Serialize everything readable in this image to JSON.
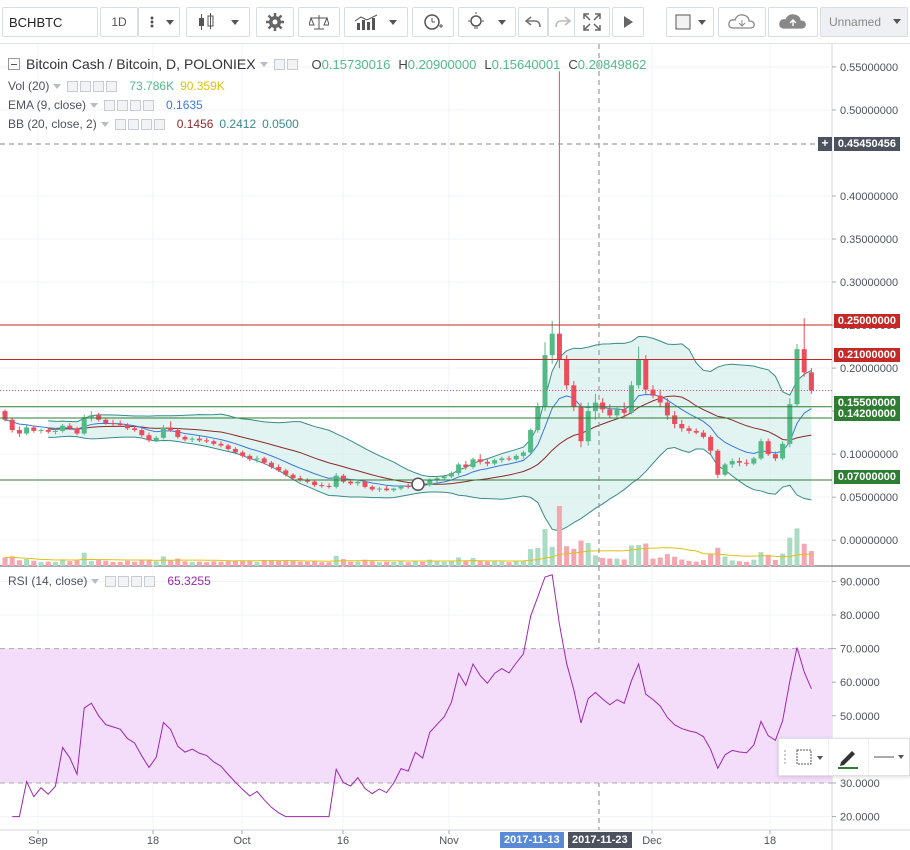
{
  "toolbar": {
    "symbol": "BCHBTC",
    "interval": "1D",
    "layout_name": "Unnamed",
    "icons": [
      "more-dots-icon",
      "candle-style-icon",
      "settings-gear-icon",
      "compare-scales-icon",
      "indicators-icon",
      "alert-clock-icon",
      "bulb-icon",
      "undo-icon",
      "redo-icon",
      "fullscreen-icon",
      "play-icon",
      "drawing-square-icon",
      "cloud-download-icon",
      "cloud-upload-icon"
    ]
  },
  "main_legend": {
    "title": "Bitcoin Cash / Bitcoin, D, POLONIEX",
    "open_key": "O",
    "open": "0.15730016",
    "high_key": "H",
    "high": "0.20900000",
    "low_key": "L",
    "low": "0.15640001",
    "close_key": "C",
    "close": "0.20849862"
  },
  "indicators": [
    {
      "name": "Vol (20)",
      "values": [
        "73.786K",
        "90.359K"
      ],
      "colors": [
        "#53b987",
        "#e0c10f"
      ]
    },
    {
      "name": "EMA (9, close)",
      "values": [
        "0.1635"
      ],
      "colors": [
        "#3c78d8"
      ]
    },
    {
      "name": "BB (20, close, 2)",
      "values": [
        "0.1456",
        "0.2412",
        "0.0500"
      ],
      "colors": [
        "#8c2a2a",
        "#3a8a8a",
        "#3a8a8a"
      ]
    }
  ],
  "rsi_legend": {
    "name": "RSI (14, close)",
    "value": "65.3255",
    "color": "#9c27b0"
  },
  "price_axis": [
    "0.55000000",
    "0.50000000",
    "0.45450456",
    "0.40000000",
    "0.35000000",
    "0.30000000",
    "0.25000000",
    "0.20000000",
    "0.15000000",
    "0.10000000",
    "0.05000000",
    "0.00000000"
  ],
  "rsi_axis": [
    "90.0000",
    "80.0000",
    "70.0000",
    "60.0000",
    "50.0000",
    "40.0000",
    "30.0000",
    "20.0000"
  ],
  "time_axis": [
    "Sep",
    "18",
    "Oct",
    "16",
    "Nov",
    "Dec",
    "18"
  ],
  "crosshair_price": "0.45450456",
  "crosshair_dates": [
    "2017-11-13",
    "2017-11-23"
  ],
  "horizontal_levels": [
    {
      "label": "0.25000000",
      "color": "#c62828"
    },
    {
      "label": "0.21000000",
      "color": "#c62828"
    },
    {
      "label": "0.15500000",
      "color": "#2e7d32"
    },
    {
      "label": "0.14200000",
      "color": "#2e7d32"
    },
    {
      "label": "0.07000000",
      "color": "#2e7d32"
    }
  ],
  "colors": {
    "up": "#53b987",
    "down": "#eb4d5c",
    "bb_fill": "#c8ebe6",
    "rsi_band": "#f3ddfa",
    "rsi_line": "#9c27b0",
    "vol_ma": "#e0c10f",
    "ema": "#3c78d8",
    "bb_basis": "#8c2a2a",
    "bb_band": "#3a8a8a"
  },
  "chart_data": {
    "type": "candlestick",
    "series_name": "BCHBTC",
    "price_range": [
      -0.03,
      0.565
    ],
    "rsi_range": [
      16,
      94
    ],
    "candles": [
      [
        0.15,
        0.152,
        0.138,
        0.14
      ],
      [
        0.14,
        0.142,
        0.125,
        0.128
      ],
      [
        0.128,
        0.132,
        0.12,
        0.124
      ],
      [
        0.124,
        0.134,
        0.122,
        0.131
      ],
      [
        0.131,
        0.133,
        0.125,
        0.127
      ],
      [
        0.127,
        0.13,
        0.124,
        0.128
      ],
      [
        0.128,
        0.131,
        0.124,
        0.126
      ],
      [
        0.126,
        0.13,
        0.123,
        0.127
      ],
      [
        0.127,
        0.135,
        0.125,
        0.133
      ],
      [
        0.133,
        0.136,
        0.128,
        0.13
      ],
      [
        0.13,
        0.132,
        0.122,
        0.124
      ],
      [
        0.124,
        0.146,
        0.122,
        0.143
      ],
      [
        0.143,
        0.15,
        0.138,
        0.145
      ],
      [
        0.145,
        0.148,
        0.138,
        0.14
      ],
      [
        0.14,
        0.142,
        0.134,
        0.136
      ],
      [
        0.136,
        0.14,
        0.133,
        0.135
      ],
      [
        0.135,
        0.139,
        0.132,
        0.134
      ],
      [
        0.134,
        0.136,
        0.128,
        0.13
      ],
      [
        0.13,
        0.133,
        0.126,
        0.128
      ],
      [
        0.128,
        0.131,
        0.12,
        0.122
      ],
      [
        0.122,
        0.125,
        0.114,
        0.116
      ],
      [
        0.116,
        0.121,
        0.114,
        0.119
      ],
      [
        0.119,
        0.134,
        0.117,
        0.131
      ],
      [
        0.131,
        0.138,
        0.126,
        0.128
      ],
      [
        0.128,
        0.13,
        0.118,
        0.12
      ],
      [
        0.12,
        0.122,
        0.115,
        0.117
      ],
      [
        0.117,
        0.12,
        0.114,
        0.118
      ],
      [
        0.118,
        0.121,
        0.114,
        0.116
      ],
      [
        0.116,
        0.119,
        0.113,
        0.115
      ],
      [
        0.115,
        0.117,
        0.11,
        0.112
      ],
      [
        0.112,
        0.115,
        0.108,
        0.11
      ],
      [
        0.11,
        0.112,
        0.104,
        0.106
      ],
      [
        0.106,
        0.108,
        0.1,
        0.102
      ],
      [
        0.102,
        0.104,
        0.096,
        0.098
      ],
      [
        0.098,
        0.1,
        0.092,
        0.094
      ],
      [
        0.094,
        0.098,
        0.09,
        0.095
      ],
      [
        0.095,
        0.097,
        0.088,
        0.09
      ],
      [
        0.09,
        0.092,
        0.083,
        0.085
      ],
      [
        0.085,
        0.088,
        0.079,
        0.081
      ],
      [
        0.081,
        0.083,
        0.074,
        0.076
      ],
      [
        0.076,
        0.078,
        0.07,
        0.072
      ],
      [
        0.072,
        0.075,
        0.068,
        0.07
      ],
      [
        0.07,
        0.072,
        0.066,
        0.068
      ],
      [
        0.068,
        0.07,
        0.062,
        0.064
      ],
      [
        0.064,
        0.067,
        0.061,
        0.063
      ],
      [
        0.063,
        0.066,
        0.06,
        0.062
      ],
      [
        0.062,
        0.078,
        0.06,
        0.075
      ],
      [
        0.075,
        0.077,
        0.066,
        0.068
      ],
      [
        0.068,
        0.071,
        0.064,
        0.066
      ],
      [
        0.066,
        0.07,
        0.063,
        0.068
      ],
      [
        0.068,
        0.07,
        0.06,
        0.062
      ],
      [
        0.062,
        0.064,
        0.057,
        0.059
      ],
      [
        0.059,
        0.062,
        0.056,
        0.06
      ],
      [
        0.06,
        0.063,
        0.057,
        0.058
      ],
      [
        0.058,
        0.061,
        0.056,
        0.06
      ],
      [
        0.06,
        0.064,
        0.058,
        0.063
      ],
      [
        0.063,
        0.066,
        0.06,
        0.062
      ],
      [
        0.062,
        0.067,
        0.06,
        0.066
      ],
      [
        0.066,
        0.068,
        0.062,
        0.064
      ],
      [
        0.064,
        0.072,
        0.062,
        0.07
      ],
      [
        0.07,
        0.074,
        0.066,
        0.072
      ],
      [
        0.072,
        0.076,
        0.07,
        0.074
      ],
      [
        0.074,
        0.08,
        0.072,
        0.078
      ],
      [
        0.078,
        0.09,
        0.075,
        0.088
      ],
      [
        0.088,
        0.092,
        0.082,
        0.085
      ],
      [
        0.085,
        0.096,
        0.083,
        0.094
      ],
      [
        0.094,
        0.1,
        0.088,
        0.091
      ],
      [
        0.091,
        0.094,
        0.086,
        0.089
      ],
      [
        0.089,
        0.095,
        0.087,
        0.093
      ],
      [
        0.093,
        0.097,
        0.09,
        0.095
      ],
      [
        0.095,
        0.098,
        0.092,
        0.094
      ],
      [
        0.094,
        0.1,
        0.092,
        0.098
      ],
      [
        0.098,
        0.104,
        0.095,
        0.102
      ],
      [
        0.102,
        0.13,
        0.1,
        0.128
      ],
      [
        0.128,
        0.16,
        0.125,
        0.155
      ],
      [
        0.155,
        0.23,
        0.15,
        0.215
      ],
      [
        0.215,
        0.255,
        0.205,
        0.24
      ],
      [
        0.24,
        0.545,
        0.2,
        0.21
      ],
      [
        0.21,
        0.215,
        0.175,
        0.18
      ],
      [
        0.18,
        0.185,
        0.15,
        0.155
      ],
      [
        0.155,
        0.16,
        0.108,
        0.115
      ],
      [
        0.115,
        0.16,
        0.11,
        0.15
      ],
      [
        0.15,
        0.17,
        0.14,
        0.16
      ],
      [
        0.16,
        0.165,
        0.148,
        0.152
      ],
      [
        0.152,
        0.158,
        0.142,
        0.145
      ],
      [
        0.145,
        0.155,
        0.14,
        0.152
      ],
      [
        0.152,
        0.16,
        0.142,
        0.148
      ],
      [
        0.148,
        0.185,
        0.146,
        0.18
      ],
      [
        0.18,
        0.225,
        0.176,
        0.21
      ],
      [
        0.21,
        0.215,
        0.17,
        0.175
      ],
      [
        0.175,
        0.18,
        0.165,
        0.168
      ],
      [
        0.168,
        0.175,
        0.155,
        0.16
      ],
      [
        0.16,
        0.165,
        0.14,
        0.145
      ],
      [
        0.145,
        0.15,
        0.13,
        0.135
      ],
      [
        0.135,
        0.14,
        0.126,
        0.13
      ],
      [
        0.13,
        0.133,
        0.124,
        0.127
      ],
      [
        0.127,
        0.13,
        0.123,
        0.125
      ],
      [
        0.125,
        0.128,
        0.118,
        0.12
      ],
      [
        0.12,
        0.122,
        0.1,
        0.104
      ],
      [
        0.104,
        0.106,
        0.072,
        0.076
      ],
      [
        0.076,
        0.09,
        0.074,
        0.088
      ],
      [
        0.088,
        0.095,
        0.084,
        0.092
      ],
      [
        0.092,
        0.096,
        0.086,
        0.09
      ],
      [
        0.09,
        0.094,
        0.086,
        0.089
      ],
      [
        0.089,
        0.097,
        0.087,
        0.095
      ],
      [
        0.095,
        0.118,
        0.093,
        0.115
      ],
      [
        0.115,
        0.118,
        0.098,
        0.1
      ],
      [
        0.1,
        0.103,
        0.092,
        0.095
      ],
      [
        0.095,
        0.115,
        0.093,
        0.112
      ],
      [
        0.112,
        0.165,
        0.108,
        0.158
      ],
      [
        0.158,
        0.228,
        0.155,
        0.222
      ],
      [
        0.222,
        0.258,
        0.19,
        0.195
      ],
      [
        0.195,
        0.2,
        0.17,
        0.174
      ]
    ]
  }
}
